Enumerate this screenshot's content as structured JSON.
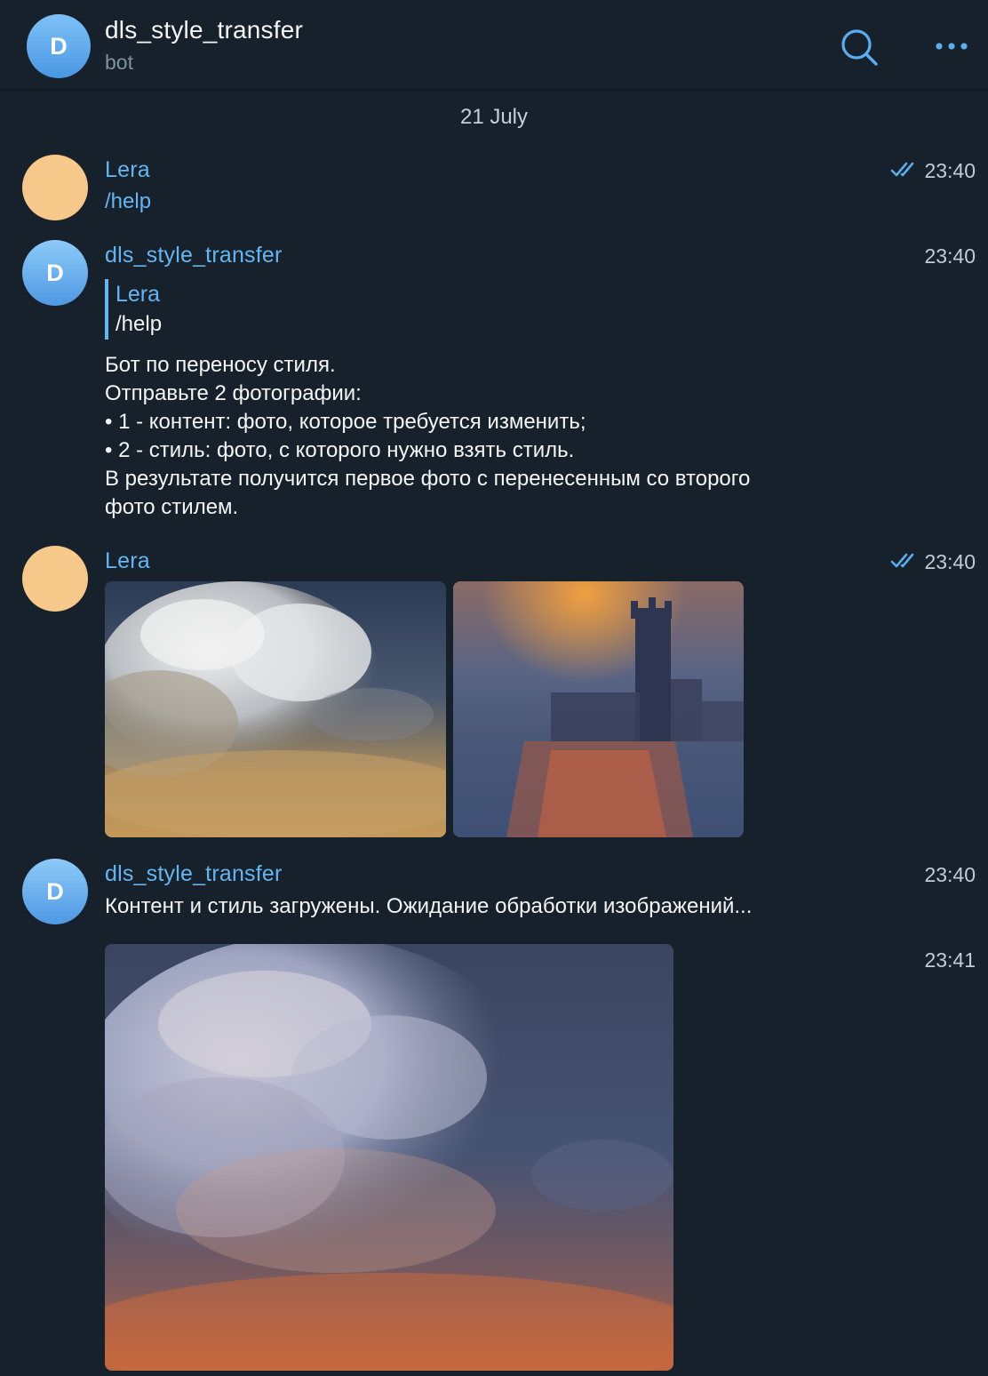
{
  "header": {
    "avatar_letter": "D",
    "title": "dls_style_transfer",
    "subtitle": "bot"
  },
  "date_separator": "21 July",
  "messages": [
    {
      "sender": "Lera",
      "avatar_color": "#f6c98a",
      "time": "23:40",
      "read": true,
      "text": "/help"
    },
    {
      "sender": "dls_style_transfer",
      "avatar_letter": "D",
      "time": "23:40",
      "reply_to": {
        "name": "Lera",
        "text": "/help"
      },
      "lines": [
        "Бот по переносу стиля.",
        "Отправьте 2 фотографии:",
        "• 1 - контент:  фото, которое требуется изменить;",
        "• 2 - стиль: фото, с которого нужно взять стиль.",
        "В результате получится первое фото с перенесенным со второго",
        "фото стилем."
      ]
    },
    {
      "sender": "Lera",
      "avatar_color": "#f6c98a",
      "time": "23:40",
      "read": true,
      "photos": [
        "clouds-photo",
        "parliament-painting"
      ]
    },
    {
      "sender": "dls_style_transfer",
      "avatar_letter": "D",
      "time": "23:40",
      "text": "Контент и стиль загружены. Ожидание обработки изображений..."
    },
    {
      "time": "23:41",
      "photos": [
        "stylized-result-photo"
      ]
    }
  ],
  "colors": {
    "background": "#17212b",
    "accent": "#64b6f2",
    "secondary_text": "#7f91a4"
  }
}
